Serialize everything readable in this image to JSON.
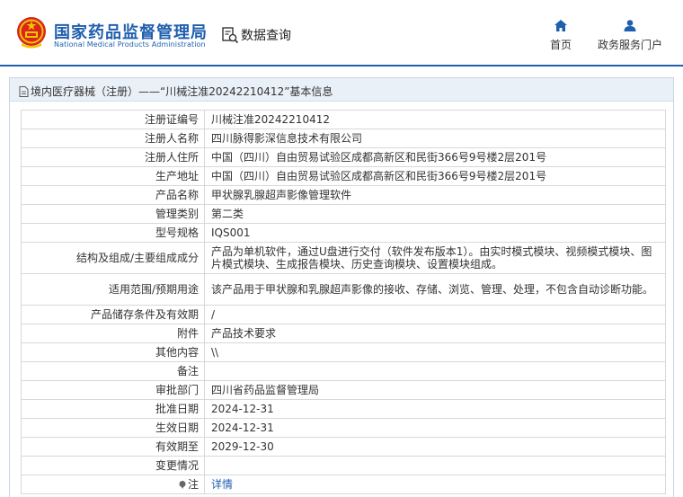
{
  "header": {
    "logo_cn": "国家药品监督管理局",
    "logo_en": "National Medical Products Administration",
    "query_title": "数据查询",
    "nav": [
      {
        "label": "首页",
        "icon": "home-icon"
      },
      {
        "label": "政务服务门户",
        "icon": "user-icon"
      }
    ],
    "accent_color": "#1f5fae"
  },
  "panel": {
    "title": "境内医疗器械（注册）——“川械注准20242210412”基本信息"
  },
  "rows": [
    {
      "label": "注册证编号",
      "value": "川械注准20242210412"
    },
    {
      "label": "注册人名称",
      "value": "四川脉得影深信息技术有限公司"
    },
    {
      "label": "注册人住所",
      "value": "中国（四川）自由贸易试验区成都高新区和民街366号9号楼2层201号"
    },
    {
      "label": "生产地址",
      "value": "中国（四川）自由贸易试验区成都高新区和民街366号9号楼2层201号"
    },
    {
      "label": "产品名称",
      "value": "甲状腺乳腺超声影像管理软件"
    },
    {
      "label": "管理类别",
      "value": "第二类"
    },
    {
      "label": "型号规格",
      "value": "IQS001"
    },
    {
      "label": "结构及组成/主要组成成分",
      "value": "产品为单机软件，通过U盘进行交付（软件发布版本1）。由实时模式模块、视频模式模块、图片模式模块、生成报告模块、历史查询模块、设置模块组成。"
    },
    {
      "label": "适用范围/预期用途",
      "value": "该产品用于甲状腺和乳腺超声影像的接收、存储、浏览、管理、处理，不包含自动诊断功能。"
    },
    {
      "label": "产品储存条件及有效期",
      "value": "/"
    },
    {
      "label": "附件",
      "value": "产品技术要求"
    },
    {
      "label": "其他内容",
      "value": "\\\\"
    },
    {
      "label": "备注",
      "value": ""
    },
    {
      "label": "审批部门",
      "value": "四川省药品监督管理局"
    },
    {
      "label": "批准日期",
      "value": "2024-12-31"
    },
    {
      "label": "生效日期",
      "value": "2024-12-31"
    },
    {
      "label": "有效期至",
      "value": "2029-12-30"
    },
    {
      "label": "变更情况",
      "value": ""
    }
  ],
  "note_row": {
    "label": "注",
    "link_text": "详情"
  }
}
